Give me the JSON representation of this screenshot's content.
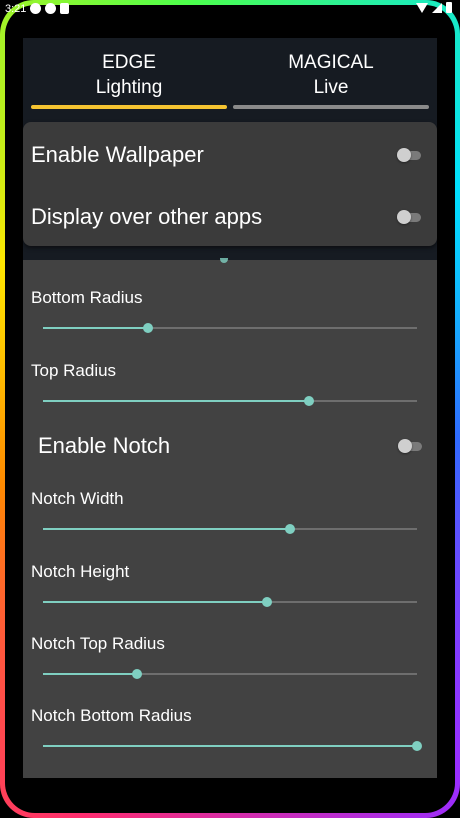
{
  "statusbar": {
    "time": "3:21"
  },
  "tabs": [
    {
      "label_line1": "EDGE",
      "label_line2": "Lighting",
      "active": true
    },
    {
      "label_line1": "MAGICAL",
      "label_line2": "Live",
      "active": false
    }
  ],
  "settings_card": {
    "wallpaper_label": "Enable Wallpaper",
    "wallpaper_enabled": false,
    "overlay_label": "Display over other apps",
    "overlay_enabled": false
  },
  "sliders": {
    "bottom_radius": {
      "label": "Bottom Radius",
      "value": 0.28
    },
    "top_radius": {
      "label": "Top Radius",
      "value": 0.71
    },
    "notch_width": {
      "label": "Notch Width",
      "value": 0.66
    },
    "notch_height": {
      "label": "Notch Height",
      "value": 0.6
    },
    "notch_top_radius": {
      "label": "Notch Top Radius",
      "value": 0.25
    },
    "notch_bottom_radius": {
      "label": "Notch Bottom Radius",
      "value": 1.0
    }
  },
  "notch": {
    "label": "Enable Notch",
    "enabled": false
  },
  "colors": {
    "accent": "#7fcfc1",
    "tab_active": "#f5c431",
    "tab_inactive": "#8a8a8a"
  }
}
